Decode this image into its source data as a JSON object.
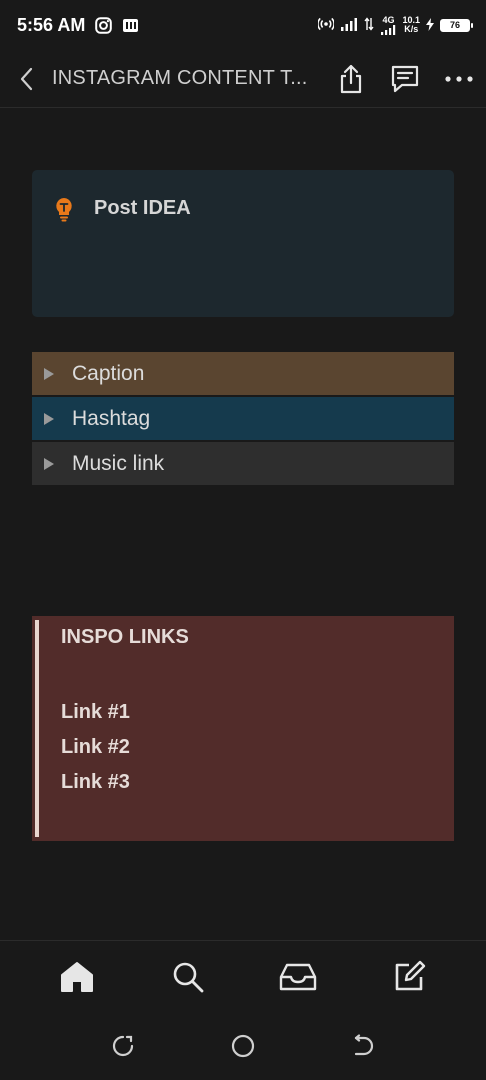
{
  "status_bar": {
    "time": "5:56 AM",
    "net_speed_value": "10.1",
    "net_speed_unit": "K/s",
    "network_type": "4G",
    "battery": "76"
  },
  "header": {
    "title": "INSTAGRAM CONTENT T..."
  },
  "callout": {
    "icon": "lightbulb-icon",
    "text": "Post IDEA",
    "background": "#1d282e"
  },
  "toggles": [
    {
      "label": "Caption",
      "background": "#5a4530"
    },
    {
      "label": "Hashtag",
      "background": "#153a4d"
    },
    {
      "label": "Music link",
      "background": "#2e2e2e"
    }
  ],
  "quote": {
    "title": "INSPO LINKS",
    "links": [
      "Link #1",
      "Link #2",
      "Link #3"
    ],
    "background": "#522c2a"
  },
  "bottom_nav": {
    "items": [
      "home-icon",
      "search-icon",
      "inbox-icon",
      "new-page-icon"
    ]
  },
  "colors": {
    "page_background": "#191919",
    "accent_orange": "#e8791a"
  }
}
